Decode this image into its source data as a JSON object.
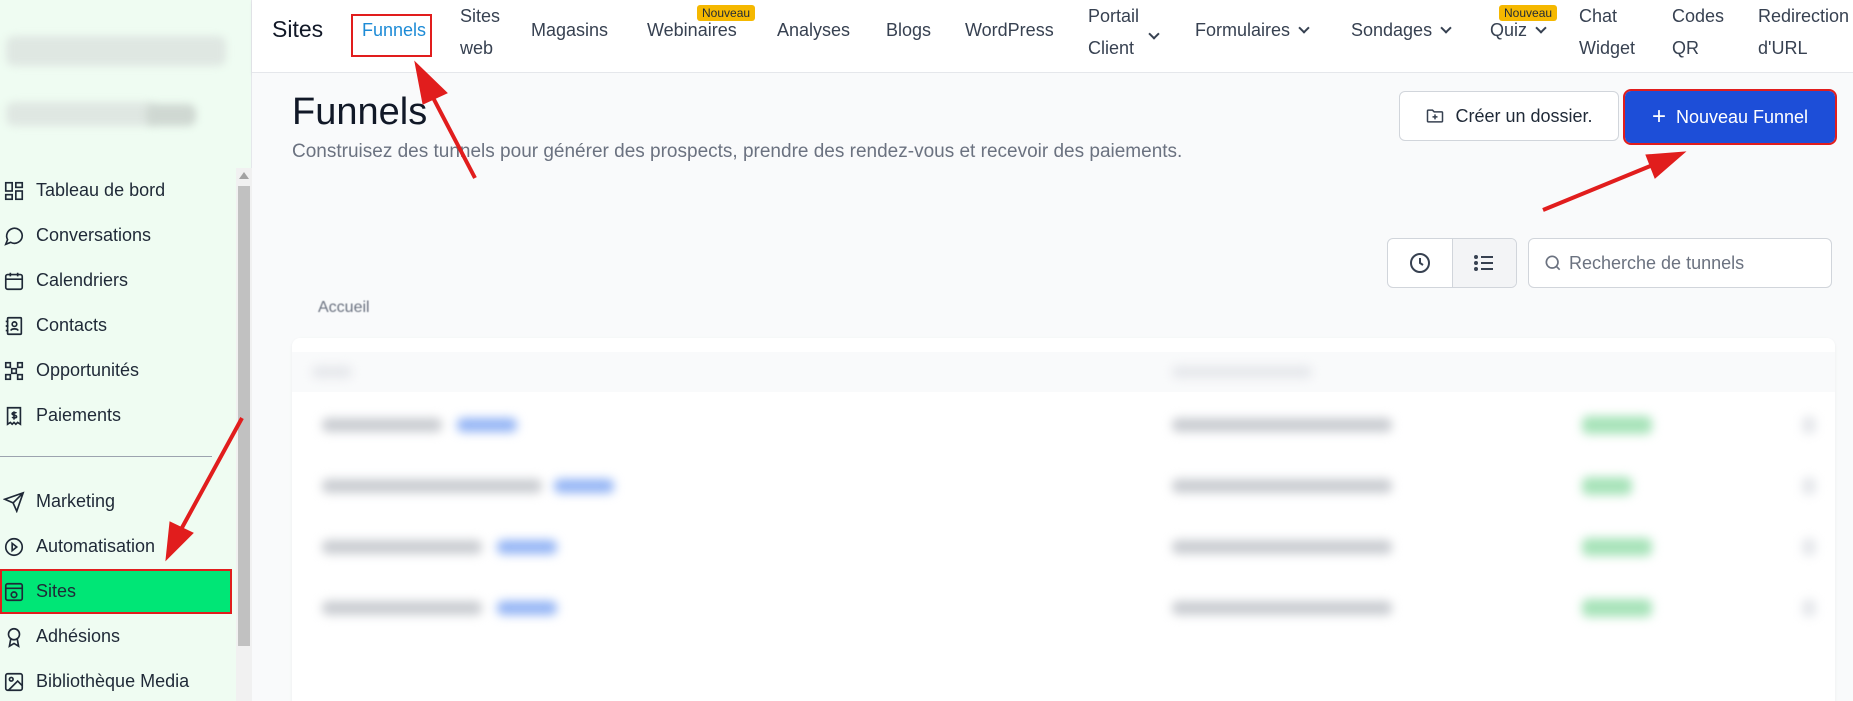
{
  "sidebar": {
    "items": [
      {
        "label": "Tableau de bord",
        "icon": "dashboard-icon"
      },
      {
        "label": "Conversations",
        "icon": "chat-bubble-icon"
      },
      {
        "label": "Calendriers",
        "icon": "calendar-icon"
      },
      {
        "label": "Contacts",
        "icon": "contact-book-icon"
      },
      {
        "label": "Opportunités",
        "icon": "opportunities-icon"
      },
      {
        "label": "Paiements",
        "icon": "payments-icon"
      }
    ],
    "items2": [
      {
        "label": "Marketing",
        "icon": "send-icon"
      },
      {
        "label": "Automatisation",
        "icon": "automation-icon"
      },
      {
        "label": "Sites",
        "icon": "sites-icon",
        "active": true
      },
      {
        "label": "Adhésions",
        "icon": "award-icon"
      },
      {
        "label": "Bibliothèque Media",
        "icon": "image-icon"
      }
    ]
  },
  "topnav": {
    "title": "Sites",
    "items": {
      "funnels": "Funnels",
      "sites_web_1": "Sites",
      "sites_web_2": "web",
      "magasins": "Magasins",
      "webinaires": "Webinaires",
      "webinaires_badge": "Nouveau",
      "analyses": "Analyses",
      "blogs": "Blogs",
      "wordpress": "WordPress",
      "portail_1": "Portail",
      "portail_2": "Client",
      "formulaires": "Formulaires",
      "sondages": "Sondages",
      "quiz": "Quiz",
      "quiz_badge": "Nouveau",
      "chat_1": "Chat",
      "chat_2": "Widget",
      "codes_1": "Codes",
      "codes_2": "QR",
      "redir_1": "Redirection",
      "redir_2": "d'URL"
    }
  },
  "main": {
    "title": "Funnels",
    "subtitle": "Construisez des tunnels pour générer des prospects, prendre des rendez-vous et recevoir des paiements.",
    "create_folder_label": "Créer un dossier.",
    "new_funnel_label": "Nouveau Funnel",
    "search_placeholder": "Recherche de tunnels",
    "breadcrumb": "Accueil"
  },
  "colors": {
    "accent": "#1d4ed8",
    "active_sidebar": "#00e676",
    "annotation": "#e11d1d",
    "active_tab": "#1d8bd6",
    "badge": "#f5b800"
  }
}
